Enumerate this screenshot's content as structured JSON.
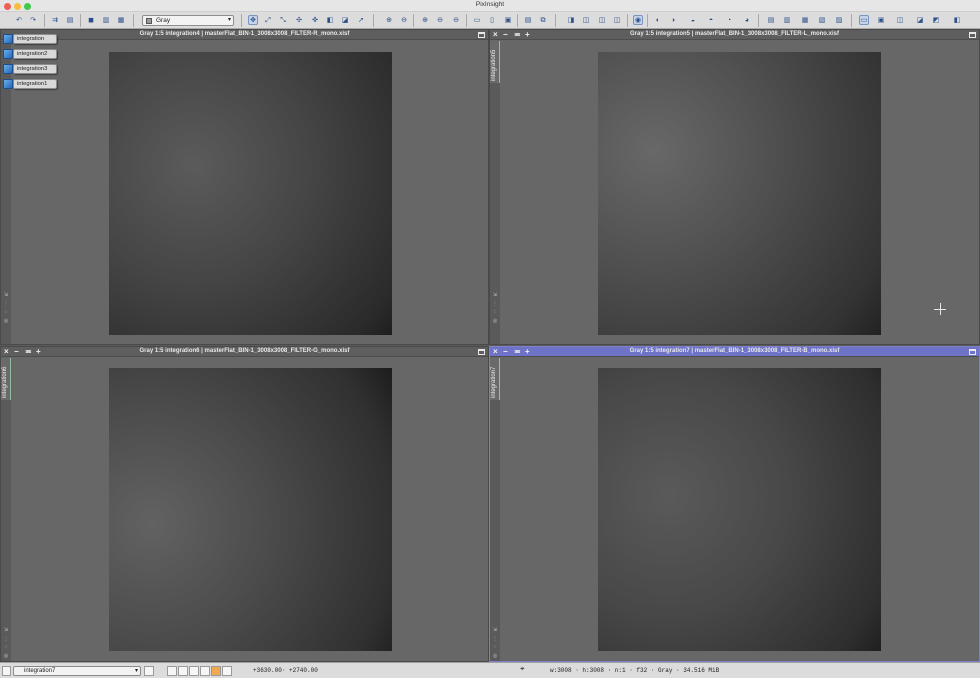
{
  "app": {
    "title": "PixInsight"
  },
  "toolbar": {
    "color_space_value": "Gray"
  },
  "shelf": {
    "items": [
      {
        "label": "integration"
      },
      {
        "label": "integration2"
      },
      {
        "label": "integration3"
      },
      {
        "label": "integration1"
      }
    ]
  },
  "windows": [
    {
      "title": "Gray 1:5 integration4 | masterFlat_BIN-1_3008x3008_FILTER-R_mono.xisf",
      "id_tab": ""
    },
    {
      "title": "Gray 1:5 integration5 | masterFlat_BIN-1_3008x3008_FILTER-L_mono.xisf",
      "id_tab": "integration5"
    },
    {
      "title": "Gray 1:5 integration6 | masterFlat_BIN-1_3008x3008_FILTER-G_mono.xisf",
      "id_tab": "integration6"
    },
    {
      "title": "Gray 1:5 integration7 | masterFlat_BIN-1_3008x3008_FILTER-B_mono.xisf",
      "id_tab": "integration7"
    }
  ],
  "window_controls": {
    "close": "×",
    "minimize": "−",
    "shade": "≖",
    "maximize": "+"
  },
  "statusbar": {
    "view_selector": "integration7",
    "coord_x": "+3630.00",
    "coord_sep": "·",
    "coord_y": "+2740.00",
    "image_info": "w:3008 · h:3008 · n:1 · f32 · Gray · 34.516 MiB"
  },
  "colors": {
    "active_title": "#6e73c8",
    "traffic_close": "#ee5f57",
    "traffic_min": "#f6bd3b",
    "traffic_max": "#3fc84a"
  }
}
